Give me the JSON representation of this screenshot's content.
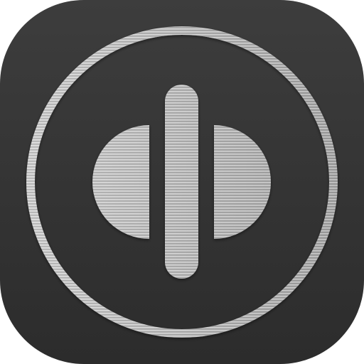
{
  "app_icon": {
    "icon": "circled-split-disc-icon",
    "colors": {
      "tile_top": "#3d3d3d",
      "tile_bottom": "#2c2c2c",
      "metal_light": "#e4e4e4",
      "metal_mid": "#bdbdbd",
      "metal_dark": "#8f8f8f"
    }
  }
}
